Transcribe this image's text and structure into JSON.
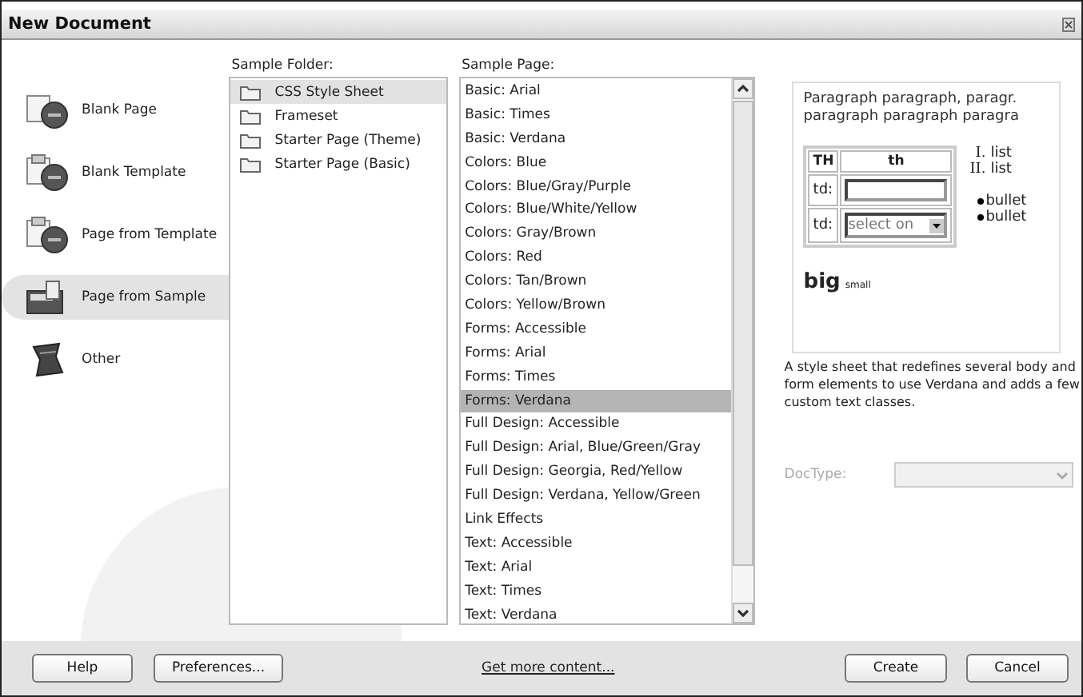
{
  "window": {
    "title": "New Document"
  },
  "categories": [
    {
      "label": "Blank Page",
      "kind": "blank",
      "selected": false
    },
    {
      "label": "Blank Template",
      "kind": "template",
      "selected": false
    },
    {
      "label": "Page from Template",
      "kind": "from-template",
      "selected": false
    },
    {
      "label": "Page from Sample",
      "kind": "sample",
      "selected": true
    },
    {
      "label": "Other",
      "kind": "other",
      "selected": false
    }
  ],
  "sample_folder": {
    "label": "Sample Folder:",
    "items": [
      {
        "label": "CSS Style Sheet",
        "selected": true
      },
      {
        "label": "Frameset",
        "selected": false
      },
      {
        "label": "Starter Page (Theme)",
        "selected": false
      },
      {
        "label": "Starter Page (Basic)",
        "selected": false
      }
    ]
  },
  "sample_page": {
    "label": "Sample Page:",
    "items": [
      {
        "label": "Basic: Arial",
        "selected": false
      },
      {
        "label": "Basic: Times",
        "selected": false
      },
      {
        "label": "Basic: Verdana",
        "selected": false
      },
      {
        "label": "Colors: Blue",
        "selected": false
      },
      {
        "label": "Colors: Blue/Gray/Purple",
        "selected": false
      },
      {
        "label": "Colors: Blue/White/Yellow",
        "selected": false
      },
      {
        "label": "Colors: Gray/Brown",
        "selected": false
      },
      {
        "label": "Colors: Red",
        "selected": false
      },
      {
        "label": "Colors: Tan/Brown",
        "selected": false
      },
      {
        "label": "Colors: Yellow/Brown",
        "selected": false
      },
      {
        "label": "Forms: Accessible",
        "selected": false
      },
      {
        "label": "Forms: Arial",
        "selected": false
      },
      {
        "label": "Forms: Times",
        "selected": false
      },
      {
        "label": "Forms: Verdana",
        "selected": true
      },
      {
        "label": "Full Design: Accessible",
        "selected": false
      },
      {
        "label": "Full Design: Arial, Blue/Green/Gray",
        "selected": false
      },
      {
        "label": "Full Design: Georgia, Red/Yellow",
        "selected": false
      },
      {
        "label": "Full Design: Verdana, Yellow/Green",
        "selected": false
      },
      {
        "label": "Link Effects",
        "selected": false
      },
      {
        "label": "Text: Accessible",
        "selected": false
      },
      {
        "label": "Text: Arial",
        "selected": false
      },
      {
        "label": "Text: Times",
        "selected": false
      },
      {
        "label": "Text: Verdana",
        "selected": false
      }
    ]
  },
  "preview": {
    "paragraph": [
      "Paragraph paragraph, paragr.",
      "paragraph paragraph paragra"
    ],
    "table": {
      "header": [
        "TH",
        "th"
      ],
      "rows": [
        {
          "label": "td:",
          "kind": "input"
        },
        {
          "label": "td:",
          "kind": "select",
          "value": "select on"
        }
      ]
    },
    "ordered": [
      {
        "marker": "I.",
        "text": "list"
      },
      {
        "marker": "II.",
        "text": "list"
      }
    ],
    "bullets": [
      "bullet",
      "bullet"
    ],
    "big": "big",
    "small": "small"
  },
  "description": "A style sheet that redefines several body and form elements to use Verdana and adds a few custom text classes.",
  "doctype": {
    "label": "DocType:",
    "disabled": true
  },
  "buttons": {
    "help": "Help",
    "preferences": "Preferences...",
    "link": "Get more content...",
    "create": "Create",
    "cancel": "Cancel"
  }
}
